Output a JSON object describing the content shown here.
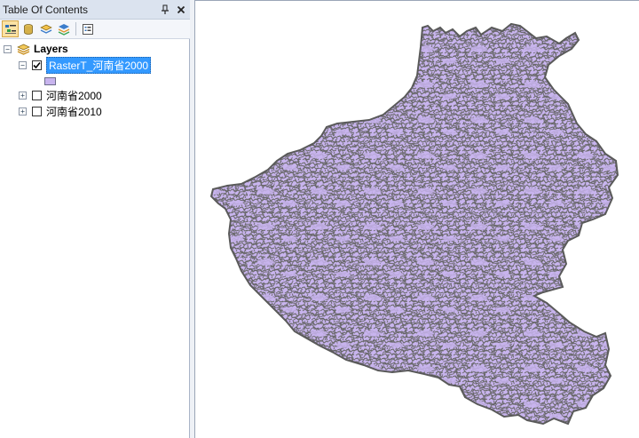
{
  "toc": {
    "title": "Table Of Contents",
    "pin_icon": "pin-icon",
    "close_icon": "close-icon",
    "toolbar": [
      {
        "name": "list-by-drawing-order-icon",
        "active": true
      },
      {
        "name": "list-by-source-icon",
        "active": false
      },
      {
        "name": "list-by-visibility-icon",
        "active": false
      },
      {
        "name": "list-by-selection-icon",
        "active": false
      },
      {
        "name": "options-icon",
        "active": false
      }
    ],
    "tree": {
      "root": {
        "label": "Layers",
        "expanded": true
      },
      "layers": [
        {
          "label": "RasterT_河南省2000",
          "checked": true,
          "expanded": true,
          "selected": true,
          "legend_color": "#c8b4ee"
        },
        {
          "label": "河南省2000",
          "checked": false,
          "expanded": false,
          "selected": false
        },
        {
          "label": "河南省2010",
          "checked": false,
          "expanded": false,
          "selected": false
        }
      ]
    }
  },
  "map": {
    "fill_color": "#c8b4ee",
    "outline_color": "#5a5a5a",
    "background": "#ffffff"
  }
}
